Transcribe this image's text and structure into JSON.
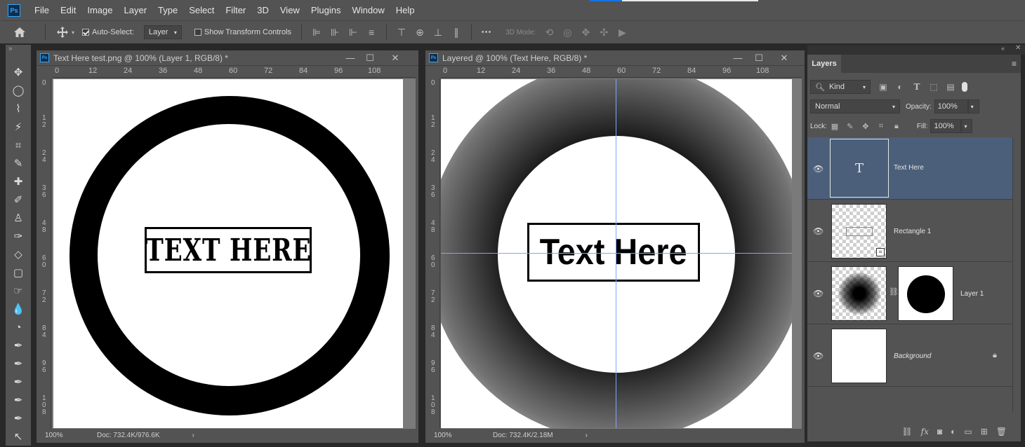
{
  "app": {
    "logo": "Ps"
  },
  "menu": [
    "File",
    "Edit",
    "Image",
    "Layer",
    "Type",
    "Select",
    "Filter",
    "3D",
    "View",
    "Plugins",
    "Window",
    "Help"
  ],
  "options": {
    "auto_select_label": "Auto-Select:",
    "auto_select_value": "Layer",
    "show_transform_label": "Show Transform Controls",
    "mode_3d_label": "3D Mode:",
    "more_label": "•••"
  },
  "documents": [
    {
      "title": "Text Here test.png @ 100% (Layer 1, RGB/8) *",
      "ruler_h": [
        "0",
        "12",
        "24",
        "36",
        "48",
        "60",
        "72",
        "84",
        "96",
        "108"
      ],
      "ruler_v": [
        "0",
        "1\n2",
        "2\n4",
        "3\n6",
        "4\n8",
        "6\n0",
        "7\n2",
        "8\n4",
        "9\n6",
        "1\n0\n8"
      ],
      "canvas_text": "TEXT HERE",
      "zoom": "100%",
      "doc_size": "Doc: 732.4K/976.6K"
    },
    {
      "title": "Layered @ 100% (Text Here, RGB/8) *",
      "ruler_h": [
        "0",
        "12",
        "24",
        "36",
        "48",
        "60",
        "72",
        "84",
        "96",
        "108"
      ],
      "ruler_v": [
        "0",
        "1\n2",
        "2\n4",
        "3\n6",
        "4\n8",
        "6\n0",
        "7\n2",
        "8\n4",
        "9\n6",
        "1\n0\n8"
      ],
      "canvas_text": "Text Here",
      "zoom": "100%",
      "doc_size": "Doc: 732.4K/2.18M"
    }
  ],
  "layers_panel": {
    "tab": "Layers",
    "filter_kind": "Kind",
    "blend_mode": "Normal",
    "opacity_label": "Opacity:",
    "opacity_value": "100%",
    "lock_label": "Lock:",
    "fill_label": "Fill:",
    "fill_value": "100%",
    "layers": [
      {
        "name": "Text Here",
        "type": "text",
        "thumb_glyph": "T",
        "selected": true
      },
      {
        "name": "Rectangle 1",
        "type": "shape",
        "selected": false
      },
      {
        "name": "Layer 1",
        "type": "masked",
        "selected": false
      },
      {
        "name": "Background",
        "type": "background",
        "selected": false
      }
    ]
  },
  "colors": {
    "accent": "#1473e6",
    "ps_blue": "#31a8ff",
    "selected_layer": "#4b5f7a",
    "guide": "#7fa6ff"
  }
}
